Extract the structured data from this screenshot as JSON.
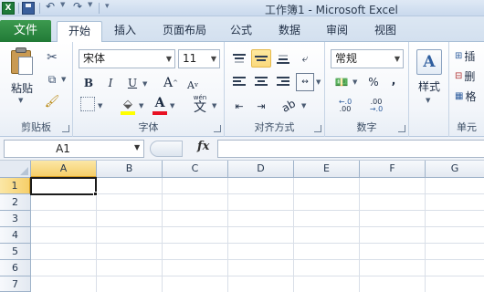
{
  "window": {
    "title": "工作簿1 - Microsoft Excel",
    "app_icon": "X"
  },
  "tabs": {
    "file": "文件",
    "items": [
      "开始",
      "插入",
      "页面布局",
      "公式",
      "数据",
      "审阅",
      "视图"
    ],
    "active": "开始"
  },
  "ribbon": {
    "clipboard": {
      "label": "剪贴板",
      "paste": "粘贴"
    },
    "font": {
      "label": "字体",
      "name": "宋体",
      "size": "11",
      "bold": "B",
      "italic": "I",
      "underline": "U",
      "grow": "A",
      "shrink": "A",
      "phonetic": "wén",
      "phonetic_char": "文",
      "fill_color": "#ffff00",
      "font_color": "#e81123"
    },
    "alignment": {
      "label": "对齐方式"
    },
    "number": {
      "label": "数字",
      "format": "常规",
      "percent": "%",
      "comma": ",",
      "inc_decimal": ".00",
      "dec_decimal": ".0"
    },
    "styles": {
      "label": "样式",
      "icon_letter": "A"
    },
    "cells": {
      "label": "单元",
      "insert": "插",
      "delete": "删",
      "format": "格"
    }
  },
  "formula_bar": {
    "name_box": "A1",
    "fx": "fx",
    "formula": ""
  },
  "grid": {
    "columns": [
      "A",
      "B",
      "C",
      "D",
      "E",
      "F",
      "G"
    ],
    "rows": [
      "1",
      "2",
      "3",
      "4",
      "5",
      "6",
      "7"
    ],
    "active_cell": "A1"
  }
}
